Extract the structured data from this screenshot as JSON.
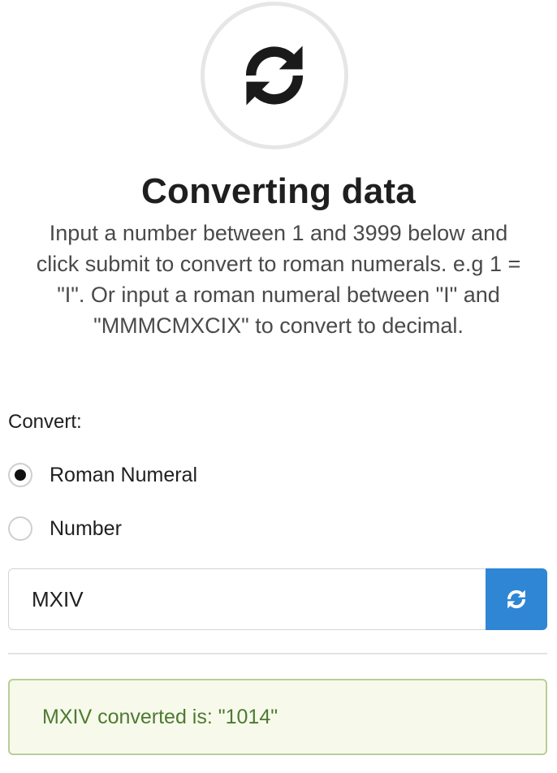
{
  "hero": {
    "icon": "refresh-icon"
  },
  "heading": {
    "title": "Converting data"
  },
  "description": {
    "line1": "Input a number between 1 and 3999 below and",
    "line2": "click submit to convert to roman numerals. e.g 1 =",
    "line3": "\"I\". Or input a roman numeral between \"I\" and",
    "line4": "\"MMMCMXCIX\" to convert to decimal."
  },
  "form": {
    "convert_label": "Convert:",
    "options": [
      {
        "label": "Roman Numeral",
        "selected": true
      },
      {
        "label": "Number",
        "selected": false
      }
    ],
    "input_value": "MXIV",
    "submit_icon": "refresh-icon"
  },
  "result": {
    "text": "MXIV converted is: \"1014\""
  },
  "colors": {
    "accent": "#2f86d4",
    "success_text": "#4d7a33",
    "success_bg": "#f7faea",
    "success_border": "#b7cf96"
  }
}
